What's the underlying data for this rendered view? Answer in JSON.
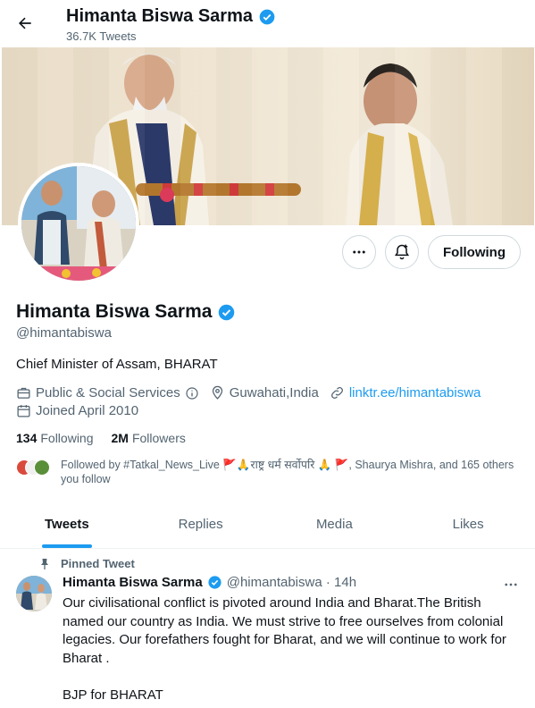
{
  "header": {
    "name": "Himanta Biswa Sarma",
    "tweet_count": "36.7K Tweets"
  },
  "profile": {
    "name": "Himanta Biswa Sarma",
    "handle": "@himantabiswa",
    "bio": "Chief Minister of Assam, BHARAT",
    "category": "Public & Social Services",
    "location": "Guwahati,India",
    "link": "linktr.ee/himantabiswa",
    "joined": "Joined April 2010",
    "following_count": "134",
    "following_label": "Following",
    "followers_count": "2M",
    "followers_label": "Followers",
    "followed_by": "Followed by #Tatkal_News_Live 🚩🙏राष्ट्र धर्म सर्वोपरि 🙏 🚩, Shaurya Mishra, and 165 others you follow",
    "follow_button": "Following"
  },
  "tabs": [
    "Tweets",
    "Replies",
    "Media",
    "Likes"
  ],
  "pinned_tweet": {
    "label": "Pinned Tweet",
    "name": "Himanta Biswa Sarma",
    "handle_time": "@himantabiswa · 14h",
    "body": "Our  civilisational conflict is pivoted around India and Bharat.The British named our country as India. We must strive to free ourselves from  colonial legacies. Our forefathers fought for Bharat, and we will continue to work for Bharat .\n\nBJP for BHARAT"
  },
  "colors": {
    "accent": "#1d9bf0",
    "text": "#0f1419",
    "muted": "#536471",
    "border": "#cfd9de"
  }
}
